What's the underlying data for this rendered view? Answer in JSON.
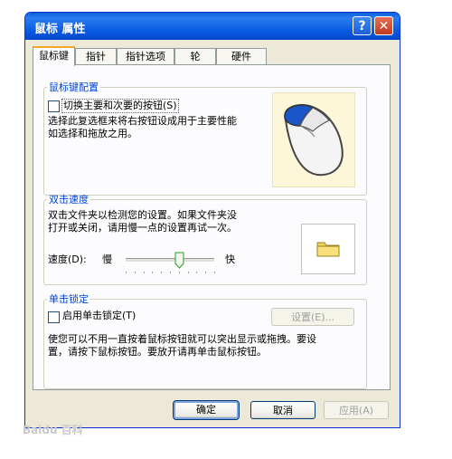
{
  "window": {
    "title": "鼠标 属性"
  },
  "tabs": [
    "鼠标键",
    "指针",
    "指针选项",
    "轮",
    "硬件"
  ],
  "buttons_config": {
    "legend": "鼠标键配置",
    "swap_label": "切换主要和次要的按钮(S)",
    "desc_line1": "选择此复选框来将右按钮设成用于主要性能",
    "desc_line2": "如选择和拖放之用。"
  },
  "double_click": {
    "legend": "双击速度",
    "desc_line1": "双击文件夹以检测您的设置。如果文件夹没",
    "desc_line2": "打开或关闭，请用慢一点的设置再试一次。",
    "speed_label": "速度(D):",
    "slow": "慢",
    "fast": "快",
    "speed_fraction": 0.6
  },
  "click_lock": {
    "legend": "单击锁定",
    "enable_label": "启用单击锁定(T)",
    "settings_button": "设置(E)...",
    "desc_line1": "使您可以不用一直按着鼠标按钮就可以突出显示或拖拽。要设",
    "desc_line2": "置，请按下鼠标按钮。要放开请再单击鼠标按钮。"
  },
  "footer": {
    "ok": "确定",
    "cancel": "取消",
    "apply": "应用(A)"
  },
  "watermark": "Baidu 百科",
  "colors": {
    "title_bar": "#0a5fd8",
    "legend": "#0046d5",
    "close": "#c13a1e",
    "active_tab_accent": "#f5a623"
  }
}
